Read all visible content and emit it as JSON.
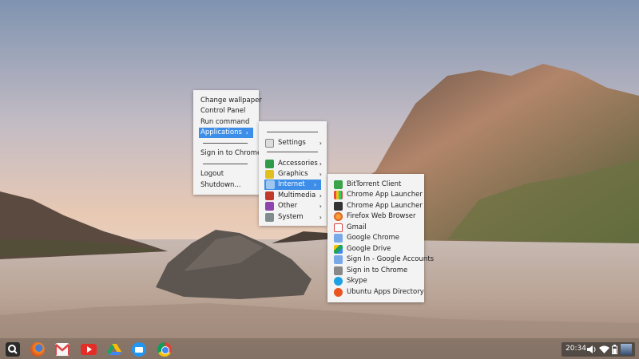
{
  "desktop_menu": {
    "items": [
      "Change wallpaper",
      "Control Panel",
      "Run command",
      "Applications",
      "Sign in to Chrome",
      "Logout",
      "Shutdown..."
    ],
    "arrow": "›"
  },
  "applications_menu": {
    "settings": "Settings",
    "categories": [
      "Accessories",
      "Graphics",
      "Internet",
      "Multimedia",
      "Other",
      "System"
    ],
    "arrow": "›"
  },
  "internet_menu": {
    "items": [
      "BitTorrent Client",
      "Chrome App Launcher",
      "Chrome App Launcher",
      "Firefox Web Browser",
      "Gmail",
      "Google Chrome",
      "Google Drive",
      "Sign In - Google Accounts",
      "Sign in to Chrome",
      "Skype",
      "Ubuntu Apps Directory"
    ],
    "icons": [
      "bittorrent-icon",
      "apps-grid-icon",
      "search-icon",
      "firefox-icon",
      "gmail-icon",
      "google-chrome-icon",
      "google-drive-icon",
      "google-accounts-icon",
      "chrome-settings-icon",
      "skype-icon",
      "ubuntu-icon"
    ]
  },
  "shelf": {
    "launchers": [
      "launcher-search-icon",
      "firefox-icon",
      "gmail-icon",
      "youtube-icon",
      "google-drive-icon",
      "files-icon",
      "chrome-icon"
    ],
    "clock": "20:34"
  },
  "colors": {
    "selection": "#3d8ee8",
    "menu_bg": "#f3f3f3"
  }
}
